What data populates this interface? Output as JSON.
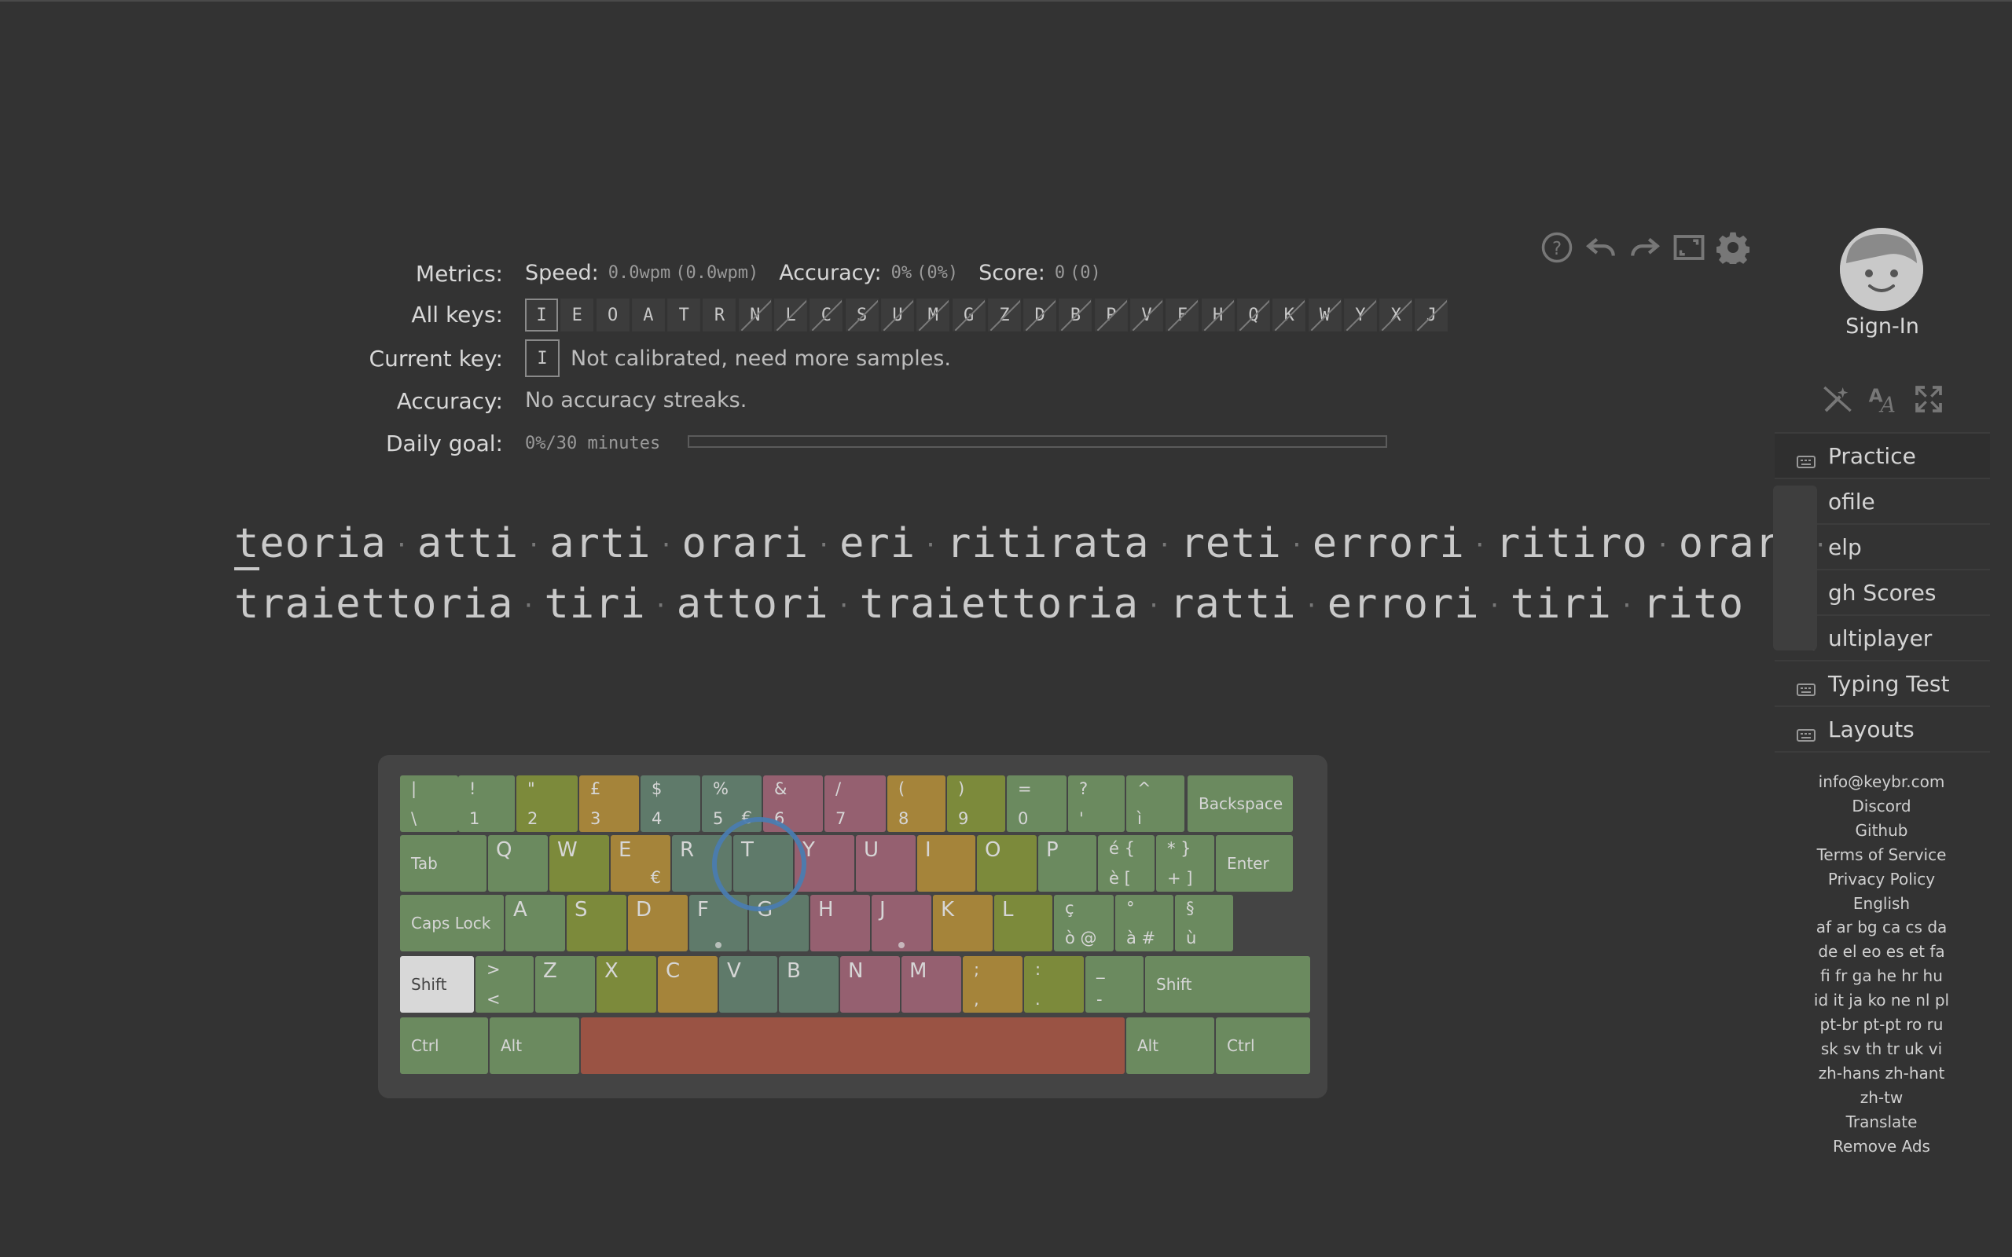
{
  "toolbar": {
    "icons": [
      "help-icon",
      "undo-icon",
      "redo-icon",
      "fullscreen-icon",
      "settings-icon"
    ]
  },
  "metrics": {
    "label": "Metrics:",
    "speed_label": "Speed:",
    "speed_value": "0.0wpm",
    "speed_paren": "(0.0wpm)",
    "accuracy_label": "Accuracy:",
    "accuracy_value": "0%",
    "accuracy_paren": "(0%)",
    "score_label": "Score:",
    "score_value": "0",
    "score_paren": "(0)"
  },
  "all_keys": {
    "label": "All keys:",
    "keys": [
      "I",
      "E",
      "O",
      "A",
      "T",
      "R",
      "N",
      "L",
      "C",
      "S",
      "U",
      "M",
      "G",
      "Z",
      "D",
      "B",
      "P",
      "V",
      "F",
      "H",
      "Q",
      "K",
      "W",
      "Y",
      "X",
      "J"
    ],
    "unlocked_count": 6
  },
  "current_key": {
    "label": "Current key:",
    "key": "I",
    "status": "Not calibrated, need more samples."
  },
  "accuracy": {
    "label": "Accuracy:",
    "text": "No accuracy streaks."
  },
  "daily_goal": {
    "label": "Daily goal:",
    "text": "0%/30 minutes",
    "progress": 0
  },
  "practice_text": {
    "line1": [
      "teoria",
      "atti",
      "arti",
      "orari",
      "eri",
      "ritirata",
      "reti",
      "errori",
      "ritiro",
      "orari"
    ],
    "line2": [
      "traiettoria",
      "tiri",
      "attori",
      "traiettoria",
      "ratti",
      "errori",
      "tiri",
      "rito"
    ]
  },
  "keyboard": {
    "row1": [
      {
        "top": "|",
        "bottom": "\\"
      },
      {
        "top": "!",
        "bottom": "1"
      },
      {
        "top": "\"",
        "bottom": "2"
      },
      {
        "top": "£",
        "bottom": "3"
      },
      {
        "top": "$",
        "bottom": "4"
      },
      {
        "top": "%",
        "bottom": "5",
        "right": "€"
      },
      {
        "top": "&",
        "bottom": "6"
      },
      {
        "top": "/",
        "bottom": "7"
      },
      {
        "top": "(",
        "bottom": "8"
      },
      {
        "top": ")",
        "bottom": "9"
      },
      {
        "top": "=",
        "bottom": "0"
      },
      {
        "top": "?",
        "bottom": "'"
      },
      {
        "top": "^",
        "bottom": "ì"
      },
      {
        "label": "Backspace"
      }
    ],
    "row2": [
      {
        "label": "Tab"
      },
      {
        "big": "Q"
      },
      {
        "big": "W"
      },
      {
        "big": "E",
        "right": "€"
      },
      {
        "big": "R"
      },
      {
        "big": "T"
      },
      {
        "big": "Y"
      },
      {
        "big": "U"
      },
      {
        "big": "I"
      },
      {
        "big": "O"
      },
      {
        "big": "P"
      },
      {
        "top": "é  {",
        "bottom": "è  ["
      },
      {
        "top": "*  }",
        "bottom": "+  ]"
      },
      {
        "label": "Enter"
      }
    ],
    "row3": [
      {
        "label": "Caps Lock"
      },
      {
        "big": "A"
      },
      {
        "big": "S"
      },
      {
        "big": "D"
      },
      {
        "big": "F"
      },
      {
        "big": "G"
      },
      {
        "big": "H"
      },
      {
        "big": "J"
      },
      {
        "big": "K"
      },
      {
        "big": "L"
      },
      {
        "top": "ç",
        "bottom": "ò  @"
      },
      {
        "top": "°",
        "bottom": "à  #"
      },
      {
        "top": "§",
        "bottom": "ù"
      }
    ],
    "row4": [
      {
        "label": "Shift"
      },
      {
        "top": ">",
        "bottom": "<"
      },
      {
        "big": "Z"
      },
      {
        "big": "X"
      },
      {
        "big": "C"
      },
      {
        "big": "V"
      },
      {
        "big": "B"
      },
      {
        "big": "N"
      },
      {
        "big": "M"
      },
      {
        "top": ";",
        "bottom": ","
      },
      {
        "top": ":",
        "bottom": "."
      },
      {
        "top": "_",
        "bottom": "-"
      },
      {
        "label": "Shift"
      }
    ],
    "row5": [
      {
        "label": "Ctrl"
      },
      {
        "label": "Alt"
      },
      {
        "label": ""
      },
      {
        "label": "Alt"
      },
      {
        "label": "Ctrl"
      }
    ],
    "highlight_key": "T"
  },
  "sidebar": {
    "sign_in": "Sign-In",
    "tool_icons": [
      "magic-wand-icon",
      "font-size-icon",
      "expand-icon"
    ],
    "nav": [
      {
        "label": "Practice",
        "icon": "keyboard-icon",
        "active": true
      },
      {
        "label": "Profile",
        "icon": "user-icon"
      },
      {
        "label": "Help",
        "icon": "help-icon"
      },
      {
        "label": "High Scores",
        "icon": "trophy-icon"
      },
      {
        "label": "Multiplayer",
        "icon": "users-icon"
      },
      {
        "label": "Typing Test",
        "icon": "speedometer-icon"
      },
      {
        "label": "Layouts",
        "icon": "keyboard-icon"
      }
    ],
    "nav_visible": [
      "Practice",
      "ofile",
      "elp",
      "gh Scores",
      "ultiplayer",
      "Typing Test",
      "Layouts"
    ],
    "links": [
      "info@keybr.com",
      "Discord",
      "Github",
      "Terms of Service",
      "Privacy Policy",
      "English",
      "af ar bg ca cs da",
      "de el eo es et fa",
      "fi fr ga he hr hu",
      "id it ja ko ne nl pl",
      "pt-br pt-pt ro ru",
      "sk sv th tr uk vi",
      "zh-hans zh-hant",
      "zh-tw",
      "Translate",
      "Remove Ads"
    ]
  },
  "colors": {
    "background": "#333333",
    "finger_green": "#6b8a5f",
    "finger_olive": "#7c8a3b",
    "finger_gold": "#a5843a",
    "finger_teal": "#5f7a6a",
    "finger_pink": "#956070",
    "thumb_red": "#9a5344",
    "focus_ring": "#4a7cb0"
  }
}
